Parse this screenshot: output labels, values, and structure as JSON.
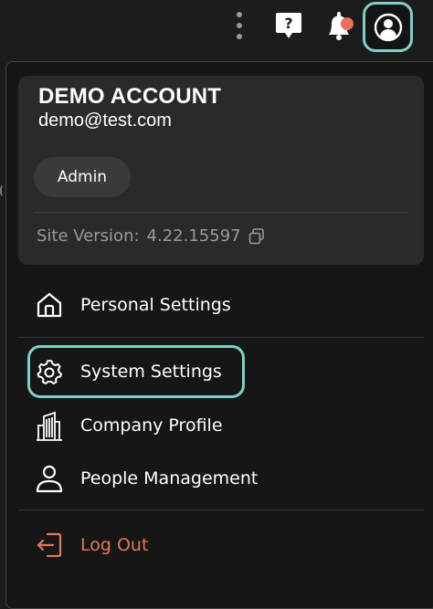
{
  "account": {
    "name": "DEMO ACCOUNT",
    "email": "demo@test.com",
    "role": "Admin",
    "site_version_label": "Site Version:",
    "site_version_value": "4.22.15597"
  },
  "menu": {
    "personal_settings": "Personal Settings",
    "system_settings": "System Settings",
    "company_profile": "Company Profile",
    "people_management": "People Management",
    "log_out": "Log Out"
  },
  "colors": {
    "accent_focus": "#7fd1c4",
    "logout": "#e07a5a",
    "notification_dot": "#e8705a"
  },
  "icons": {
    "more": "kebab-vertical-icon",
    "help": "help-bubble-icon",
    "notifications": "bell-icon",
    "profile": "user-circle-icon",
    "copy": "copy-icon",
    "personal": "home-icon",
    "system": "gear-icon",
    "company": "building-icon",
    "people": "person-icon",
    "logout": "logout-icon"
  }
}
